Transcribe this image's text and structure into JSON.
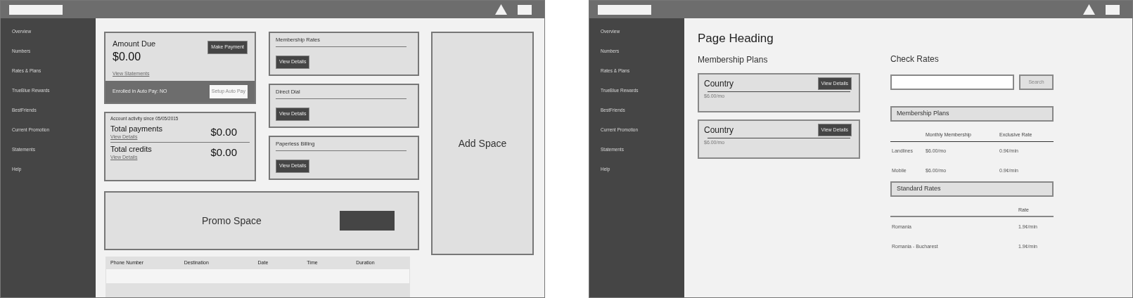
{
  "dashboard": {
    "sidebar": {
      "items": [
        "Overview",
        "Numbers",
        "Rates & Plans",
        "TrueBlue Rewards",
        "BestFriends",
        "Current Promotion",
        "Statements",
        "Help"
      ]
    },
    "amount_due": {
      "title": "Amount Due",
      "amount": "$0.00",
      "button": "Make Payment",
      "link": "View Statements",
      "autopay_text": "Enrolled in Auto Pay: NO",
      "autopay_button": "Setup Auto Pay"
    },
    "activity": {
      "title": "Account activity since 05/05/2015",
      "rows": [
        {
          "label": "Total payments",
          "link": "View Details",
          "amount": "$0.00"
        },
        {
          "label": "Total credits",
          "link": "View Details",
          "amount": "$0.00"
        }
      ]
    },
    "info_cards": [
      {
        "title": "Membership Rates",
        "button": "View Details"
      },
      {
        "title": "Direct Dial",
        "button": "View Details"
      },
      {
        "title": "Paperless Billing",
        "button": "View Details"
      }
    ],
    "ad_space": "Add Space",
    "promo": "Promo Space",
    "table": {
      "columns": [
        "Phone Number",
        "Destination",
        "Date",
        "Time",
        "Duration"
      ]
    }
  },
  "rates_page": {
    "sidebar": {
      "items": [
        "Overview",
        "Numbers",
        "Rates & Plans",
        "TrueBlue Rewards",
        "BestFriends",
        "Current Promotion",
        "Statements",
        "Help"
      ]
    },
    "heading": "Page Heading",
    "plans_title": "Membership Plans",
    "plans": [
      {
        "name": "Country",
        "button": "View Details",
        "price": "$6.00/mo"
      },
      {
        "name": "Country",
        "button": "View Details",
        "price": "$6.00/mo"
      }
    ],
    "check_title": "Check Rates",
    "search_button": "Search",
    "membership_section": {
      "title": "Membership Plans",
      "columns": [
        "Monthly Membership",
        "Exclusive Rate"
      ],
      "rows": [
        {
          "name": "Landlines",
          "monthly": "$6.00/mo",
          "rate": "0.9¢/min"
        },
        {
          "name": "Mobile",
          "monthly": "$6.00/mo",
          "rate": "0.9¢/min"
        }
      ]
    },
    "standard_section": {
      "title": "Standard Rates",
      "columns": [
        "Rate"
      ],
      "rows": [
        {
          "name": "Romania",
          "rate": "1.9¢/min"
        },
        {
          "name": "Romania - Bucharest",
          "rate": "1.9¢/min"
        }
      ]
    }
  }
}
